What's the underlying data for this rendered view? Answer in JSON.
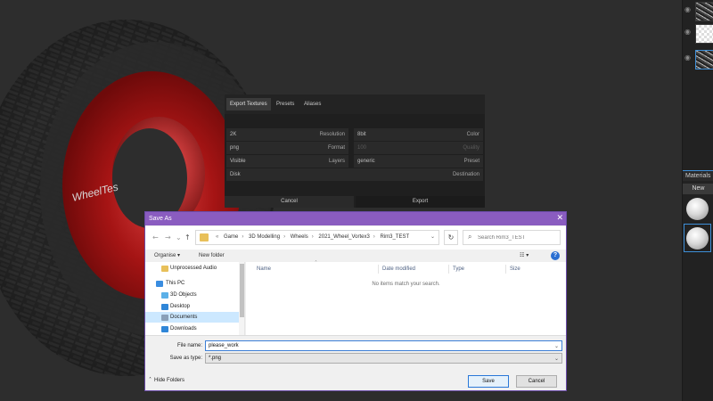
{
  "viewport": {
    "tire_text": "WheelTes"
  },
  "right_panel": {
    "materials_label": "Materials",
    "new_label": "New"
  },
  "export_panel": {
    "tabs": [
      {
        "label": "Export Textures",
        "active": true
      },
      {
        "label": "Presets",
        "active": false
      },
      {
        "label": "Aliases",
        "active": false
      }
    ],
    "fields": [
      {
        "value": "2K",
        "label": "Resolution"
      },
      {
        "value": "8bit",
        "label": "Color"
      },
      {
        "value": "png",
        "label": "Format"
      },
      {
        "value": "100",
        "label": "Quality",
        "disabled": true
      },
      {
        "value": "Visible",
        "label": "Layers"
      },
      {
        "value": "generic",
        "label": "Preset"
      },
      {
        "value": "Disk",
        "label": "Destination"
      }
    ],
    "cancel_label": "Cancel",
    "export_label": "Export"
  },
  "save_dialog": {
    "title": "Save As",
    "breadcrumbs": [
      "Game",
      "3D Modelling",
      "Wheels",
      "2021_Wheel_Vortex3",
      "Rim3_TEST"
    ],
    "search_placeholder": "Search Rim3_TEST",
    "organise_label": "Organise ▾",
    "new_folder_label": "New folder",
    "nav_items": [
      {
        "label": "Unprocessed Audio",
        "icon": "folder-icon",
        "color": "#e8c05a"
      },
      {
        "label": "This PC",
        "icon": "pc-icon",
        "color": "#3a8de0"
      },
      {
        "label": "3D Objects",
        "icon": "cube-icon",
        "color": "#5bb0e8"
      },
      {
        "label": "Desktop",
        "icon": "desktop-icon",
        "color": "#2f86d8"
      },
      {
        "label": "Documents",
        "icon": "documents-icon",
        "color": "#8aa0b8",
        "selected": true
      },
      {
        "label": "Downloads",
        "icon": "downloads-icon",
        "color": "#2f86d8"
      }
    ],
    "columns": [
      "Name",
      "Date modified",
      "Type",
      "Size"
    ],
    "empty_message": "No items match your search.",
    "file_name_label": "File name:",
    "file_name_value": "please_work",
    "save_type_label": "Save as type:",
    "save_type_value": "*.png",
    "hide_folders_label": "Hide Folders",
    "save_label": "Save",
    "cancel_label": "Cancel"
  },
  "colors": {
    "title_bar": "#8a5cc0",
    "accent": "#3d8fd8",
    "tire_red": "#a51414"
  }
}
